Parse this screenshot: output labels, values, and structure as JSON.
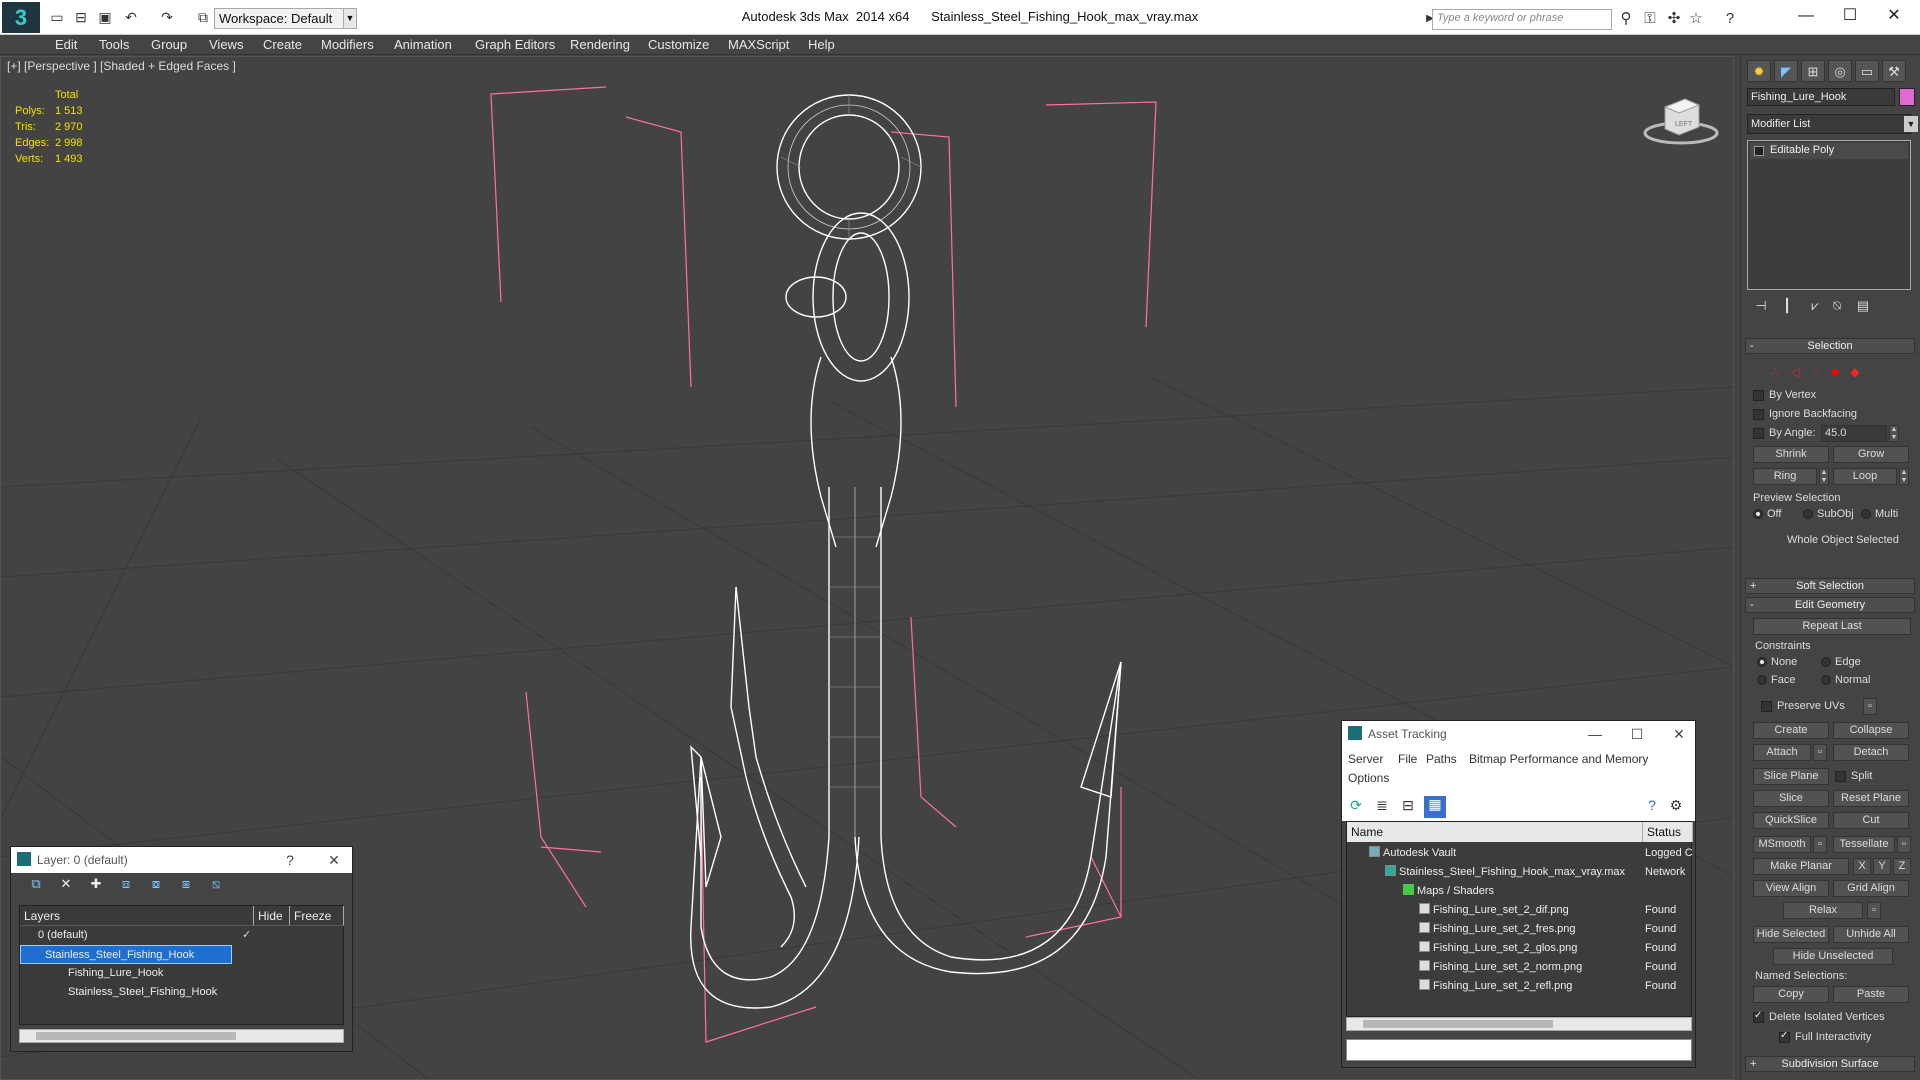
{
  "app": {
    "logo": "3",
    "workspace": "Workspace: Default",
    "title": "Autodesk 3ds Max  2014 x64      Stainless_Steel_Fishing_Hook_max_vray.max",
    "search_placeholder": "Type a keyword or phrase"
  },
  "menu": [
    "Edit",
    "Tools",
    "Group",
    "Views",
    "Create",
    "Modifiers",
    "Animation",
    "Graph Editors",
    "Rendering",
    "Customize",
    "MAXScript",
    "Help"
  ],
  "viewport": {
    "label": "[+] [Perspective ] [Shaded + Edged Faces ]",
    "stats": {
      "header": "Total",
      "rows": [
        {
          "label": "Polys:",
          "value": "1 513"
        },
        {
          "label": "Tris:",
          "value": "2 970"
        },
        {
          "label": "Edges:",
          "value": "2 998"
        },
        {
          "label": "Verts:",
          "value": "1 493"
        }
      ]
    },
    "viewcube_label": "LEFT"
  },
  "command_panel": {
    "object_name": "Fishing_Lure_Hook",
    "object_color": "#e06ad0",
    "modifier_list": "Modifier List",
    "stack_item": "Editable Poly",
    "selection": {
      "title": "Selection",
      "by_vertex": "By Vertex",
      "ignore_backfacing": "Ignore Backfacing",
      "by_angle": "By Angle:",
      "angle_value": "45.0",
      "shrink": "Shrink",
      "grow": "Grow",
      "ring": "Ring",
      "loop": "Loop",
      "preview_selection": "Preview Selection",
      "off": "Off",
      "subobj": "SubObj",
      "multi": "Multi",
      "status": "Whole Object Selected"
    },
    "soft_selection": "Soft Selection",
    "edit_geometry": {
      "title": "Edit Geometry",
      "repeat_last": "Repeat Last",
      "constraints": "Constraints",
      "none": "None",
      "edge": "Edge",
      "face": "Face",
      "normal": "Normal",
      "preserve_uvs": "Preserve UVs",
      "create": "Create",
      "collapse": "Collapse",
      "attach": "Attach",
      "detach": "Detach",
      "slice_plane": "Slice Plane",
      "split": "Split",
      "slice": "Slice",
      "reset_plane": "Reset Plane",
      "quickslice": "QuickSlice",
      "cut": "Cut",
      "msmooth": "MSmooth",
      "tessellate": "Tessellate",
      "make_planar": "Make Planar",
      "x": "X",
      "y": "Y",
      "z": "Z",
      "view_align": "View Align",
      "grid_align": "Grid Align",
      "relax": "Relax",
      "hide_selected": "Hide Selected",
      "unhide_all": "Unhide All",
      "hide_unselected": "Hide Unselected",
      "named_selections": "Named Selections:",
      "copy": "Copy",
      "paste": "Paste",
      "delete_isolated": "Delete Isolated Vertices",
      "full_interactivity": "Full Interactivity"
    },
    "subdivision_surface": "Subdivision Surface"
  },
  "asset_tracking": {
    "title": "Asset Tracking",
    "menu": [
      "Server",
      "File",
      "Paths",
      "Bitmap Performance and Memory"
    ],
    "menu2": "Options",
    "columns": [
      "Name",
      "Status"
    ],
    "rows": [
      {
        "name": "Autodesk Vault",
        "status": "Logged C",
        "indent": 1
      },
      {
        "name": "Stainless_Steel_Fishing_Hook_max_vray.max",
        "status": "Network",
        "indent": 2
      },
      {
        "name": "Maps / Shaders",
        "status": "",
        "indent": 3
      },
      {
        "name": "Fishing_Lure_set_2_dif.png",
        "status": "Found",
        "indent": 4
      },
      {
        "name": "Fishing_Lure_set_2_fres.png",
        "status": "Found",
        "indent": 4
      },
      {
        "name": "Fishing_Lure_set_2_glos.png",
        "status": "Found",
        "indent": 4
      },
      {
        "name": "Fishing_Lure_set_2_norm.png",
        "status": "Found",
        "indent": 4
      },
      {
        "name": "Fishing_Lure_set_2_refl.png",
        "status": "Found",
        "indent": 4
      }
    ]
  },
  "layer_window": {
    "title": "Layer: 0 (default)",
    "help": "?",
    "columns": [
      "Layers",
      "Hide",
      "Freeze"
    ],
    "rows": [
      {
        "name": "0 (default)",
        "indent": 1,
        "selected": false
      },
      {
        "name": "Stainless_Steel_Fishing_Hook",
        "indent": 1,
        "selected": true
      },
      {
        "name": "Fishing_Lure_Hook",
        "indent": 2,
        "selected": false
      },
      {
        "name": "Stainless_Steel_Fishing_Hook",
        "indent": 2,
        "selected": false
      }
    ]
  }
}
